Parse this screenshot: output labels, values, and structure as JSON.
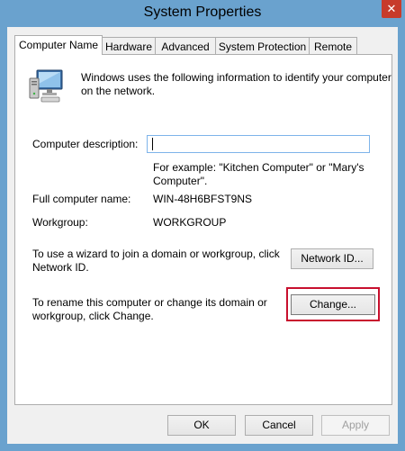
{
  "window": {
    "title": "System Properties",
    "close_label": "✕"
  },
  "tabs": [
    {
      "label": "Computer Name"
    },
    {
      "label": "Hardware"
    },
    {
      "label": "Advanced"
    },
    {
      "label": "System Protection"
    },
    {
      "label": "Remote"
    }
  ],
  "computer_name": {
    "intro_line1": "Windows uses the following information to identify your computer",
    "intro_line2": "on the network.",
    "description_label": "Computer description:",
    "description_value": "",
    "example_line1": "For example: \"Kitchen Computer\" or \"Mary's",
    "example_line2": "Computer\".",
    "full_name_label": "Full computer name:",
    "full_name_value": "WIN-48H6BFST9NS",
    "workgroup_label": "Workgroup:",
    "workgroup_value": "WORKGROUP",
    "wizard_line1": "To use a wizard to join a domain or workgroup, click",
    "wizard_line2": "Network ID.",
    "network_id_button": "Network ID...",
    "rename_line1": "To rename this computer or change its domain or",
    "rename_line2": "workgroup, click Change.",
    "change_button": "Change..."
  },
  "footer": {
    "ok": "OK",
    "cancel": "Cancel",
    "apply": "Apply"
  },
  "colors": {
    "frame": "#6aa2ce",
    "close": "#c73b2b",
    "highlight": "#c8102e",
    "focus_border": "#7eb4ea"
  }
}
